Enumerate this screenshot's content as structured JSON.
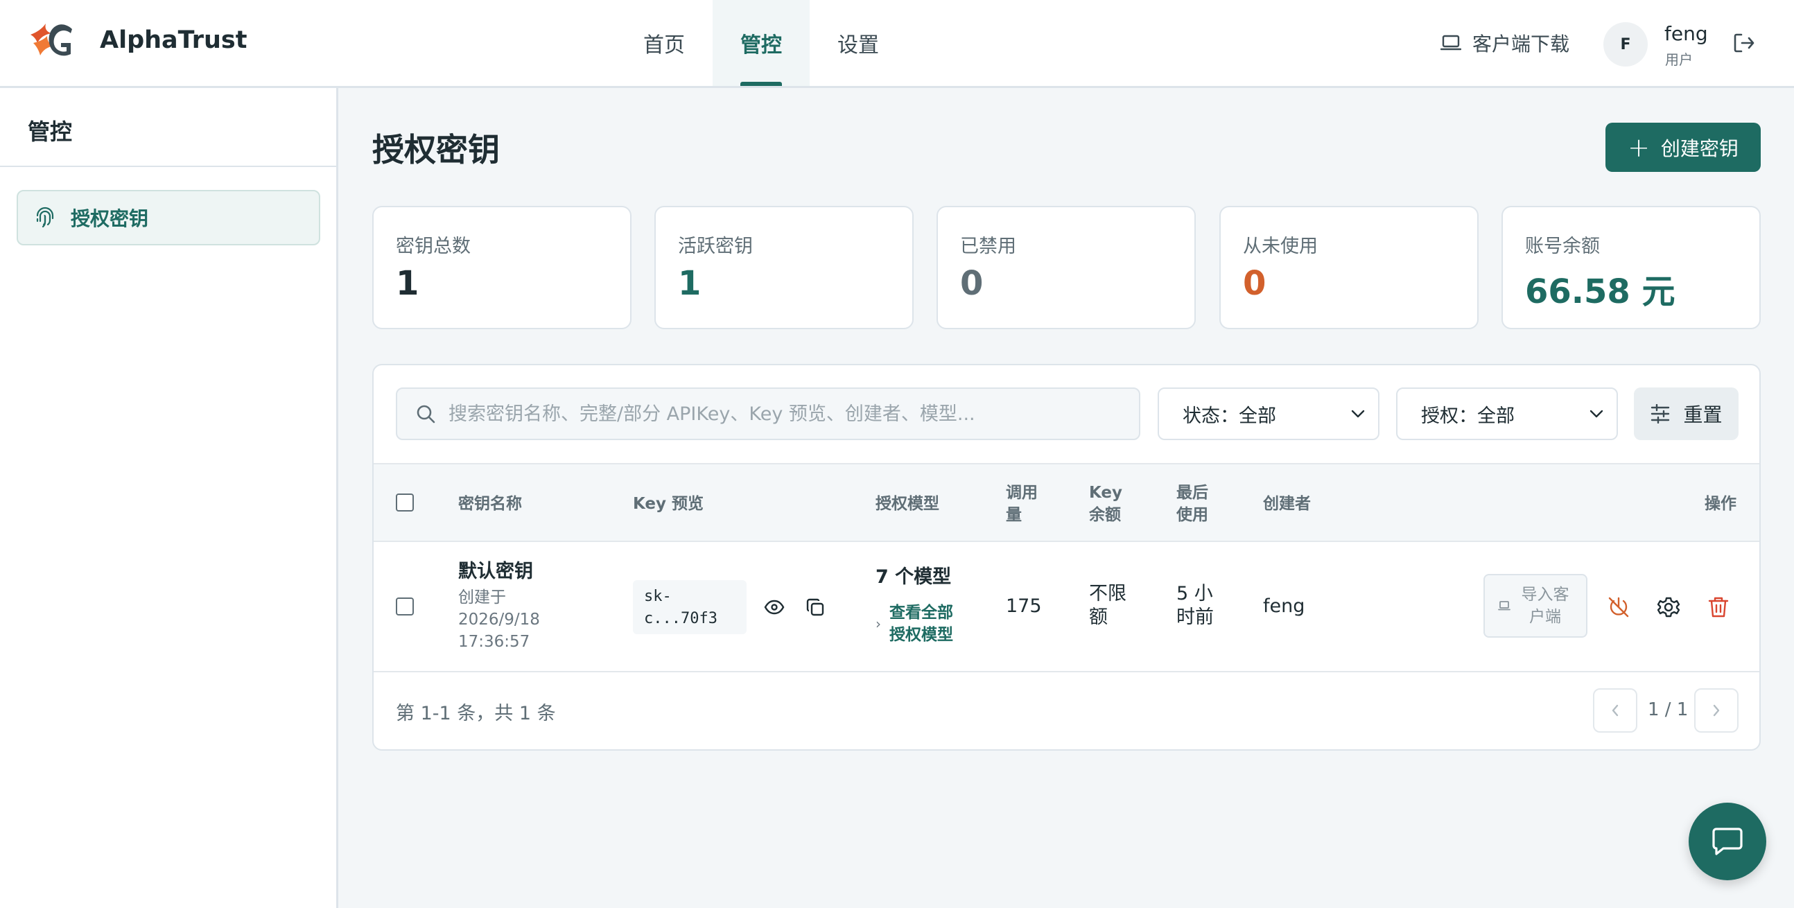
{
  "header": {
    "brand": "AlphaTrust",
    "nav": [
      {
        "label": "首页"
      },
      {
        "label": "管控"
      },
      {
        "label": "设置"
      }
    ],
    "download_label": "客户端下载",
    "user": {
      "avatar_letter": "F",
      "name": "feng",
      "role": "用户"
    }
  },
  "sidebar": {
    "title": "管控",
    "items": [
      {
        "label": "授权密钥"
      }
    ]
  },
  "main": {
    "title": "授权密钥",
    "create_label": "创建密钥",
    "stats": [
      {
        "label": "密钥总数",
        "value": "1",
        "color": "#1f2d33"
      },
      {
        "label": "活跃密钥",
        "value": "1",
        "color": "#1e6b62"
      },
      {
        "label": "已禁用",
        "value": "0",
        "color": "#5f6e76"
      },
      {
        "label": "从未使用",
        "value": "0",
        "color": "#d2602c"
      },
      {
        "label": "账号余额",
        "value": "66.58 元",
        "color": "#1e6b62"
      }
    ],
    "filters": {
      "search_placeholder": "搜索密钥名称、完整/部分 APIKey、Key 预览、创建者、模型...",
      "status_value": "状态：全部",
      "auth_value": "授权：全部",
      "reset_label": "重置"
    },
    "table": {
      "headers": {
        "name": "密钥名称",
        "preview": "Key 预览",
        "models": "授权模型",
        "calls_1": "调用",
        "calls_2": "量",
        "quota_1": "Key",
        "quota_2": "余额",
        "last_1": "最后",
        "last_2": "使用",
        "creator": "创建者",
        "actions": "操作"
      },
      "rows": [
        {
          "name": "默认密钥",
          "created_1": "创建于",
          "created_2": "2026/9/18",
          "created_3": "17:36:57",
          "preview_1": "sk-",
          "preview_2": "c...70f3",
          "models": "7 个模型",
          "view_all_1": "查看全部",
          "view_all_2": "授权模型",
          "calls": "175",
          "quota_1": "不限",
          "quota_2": "额",
          "last_1": "5 小",
          "last_2": "时前",
          "creator": "feng",
          "import_1": "导入客",
          "import_2": "户端"
        }
      ]
    },
    "pagination": {
      "summary": "第 1-1 条，共 1 条",
      "page": "1 / 1"
    }
  },
  "colors": {
    "accent": "#1e6b62",
    "warning": "#d2602c",
    "danger": "#d9452f"
  }
}
